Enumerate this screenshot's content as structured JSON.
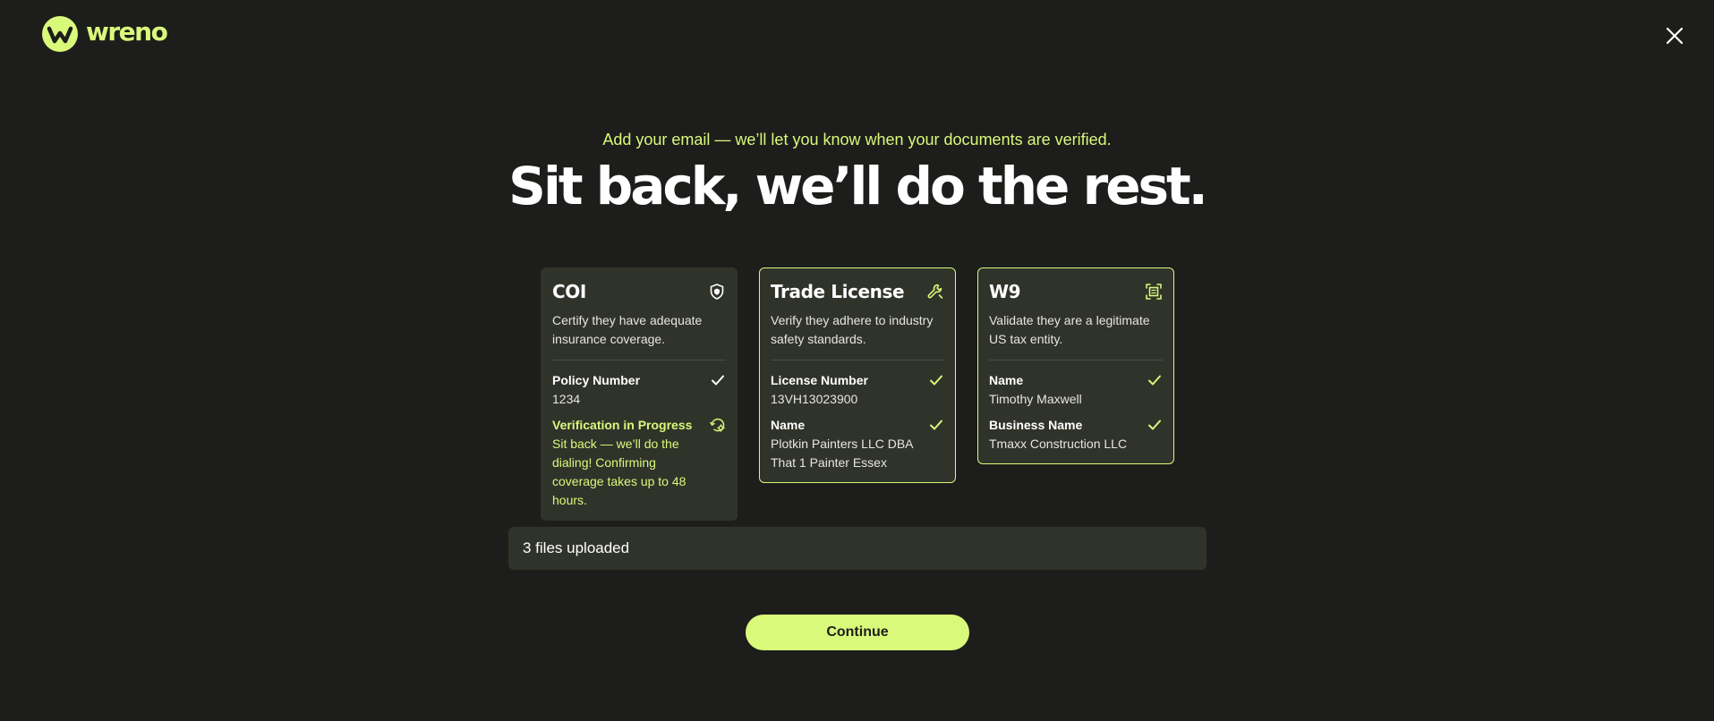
{
  "brand": {
    "name": "wreno",
    "accent": "#d9f97b",
    "background": "#1d1d1b",
    "card_bg": "#30332a"
  },
  "header": {
    "close_icon": "close-icon"
  },
  "hero": {
    "subtitle": "Add your email — we’ll let you know when your documents are verified.",
    "title": "Sit back, we’ll do the rest."
  },
  "cards": [
    {
      "title": "COI",
      "icon": "shield-icon",
      "description": "Certify they have adequate insurance coverage.",
      "fields": [
        {
          "label": "Policy Number",
          "value": "1234",
          "status": "check-icon"
        }
      ],
      "progress": {
        "label": "Verification in Progress",
        "text": "Sit back — we’ll do the dialing! Confirming coverage takes up to 48 hours.",
        "icon": "history-settings-icon"
      }
    },
    {
      "title": "Trade License",
      "icon": "wrench-icon",
      "description": "Verify they adhere to industry safety standards.",
      "fields": [
        {
          "label": "License Number",
          "value": "13VH13023900",
          "status": "check-icon"
        },
        {
          "label": "Name",
          "value": "Plotkin Painters LLC DBA That 1 Painter Essex",
          "status": "check-icon"
        }
      ]
    },
    {
      "title": "W9",
      "icon": "document-scan-icon",
      "description": "Validate they are a legitimate US tax entity.",
      "fields": [
        {
          "label": "Name",
          "value": "Timothy Maxwell",
          "status": "check-icon"
        },
        {
          "label": "Business Name",
          "value": "Tmaxx Construction LLC",
          "status": "check-icon"
        }
      ]
    }
  ],
  "files": {
    "status": "3 files uploaded"
  },
  "actions": {
    "continue_label": "Continue"
  }
}
